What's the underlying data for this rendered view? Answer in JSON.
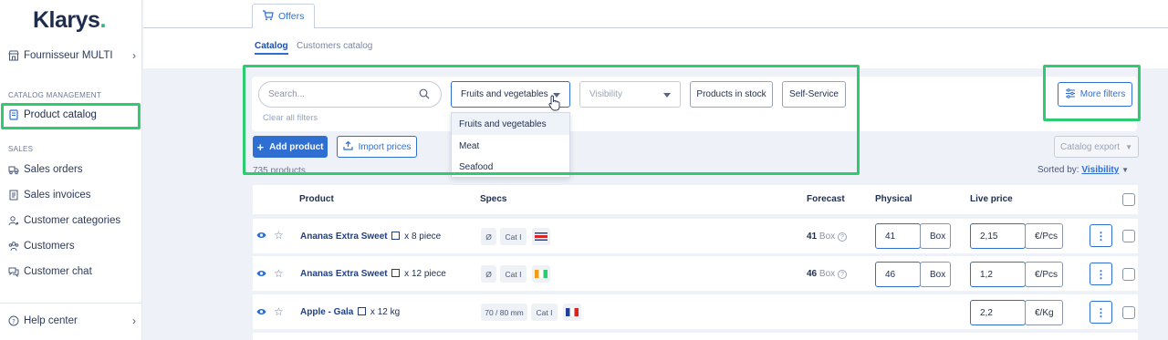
{
  "brand": {
    "name": "Klarys",
    "dot": "."
  },
  "sidebar": {
    "supplier": "Fournisseur MULTI",
    "sections": {
      "catalog_management": "CATALOG MANAGEMENT",
      "sales": "SALES"
    },
    "items": [
      {
        "label": "Product catalog",
        "icon": "book-icon",
        "active": true
      },
      {
        "label": "Sales orders",
        "icon": "truck-icon"
      },
      {
        "label": "Sales invoices",
        "icon": "invoice-icon"
      },
      {
        "label": "Customer categories",
        "icon": "users-icon"
      },
      {
        "label": "Customers",
        "icon": "people-icon"
      },
      {
        "label": "Customer chat",
        "icon": "chat-icon"
      }
    ],
    "help": "Help center"
  },
  "top_tab": {
    "label": "Offers",
    "icon": "cart-icon"
  },
  "subtabs": {
    "catalog": "Catalog",
    "customers_catalog": "Customers catalog"
  },
  "filters": {
    "search_placeholder": "Search...",
    "category_selected": "Fruits and vegetables",
    "visibility_placeholder": "Visibility",
    "products_in_stock": "Products in stock",
    "self_service": "Self-Service",
    "clear_all": "Clear all filters",
    "more_filters": "More filters",
    "category_options": [
      "Fruits and vegetables",
      "Meat",
      "Seafood"
    ]
  },
  "actions": {
    "add_product": "Add product",
    "import_prices": "Import prices",
    "catalog_export": "Catalog export"
  },
  "summary": {
    "count": "735 products",
    "sorted_by_label": "Sorted by:",
    "sorted_by_value": "Visibility"
  },
  "columns": {
    "product": "Product",
    "specs": "Specs",
    "forecast": "Forecast",
    "physical": "Physical",
    "live_price": "Live price"
  },
  "rows": [
    {
      "name": "Ananas Extra Sweet",
      "pack": "x 8 piece",
      "specs": [
        "Ø",
        "Cat I"
      ],
      "flag": "costa-rica",
      "forecast_value": "41",
      "forecast_unit": "Box",
      "physical_qty": "41",
      "physical_unit": "Box",
      "price": "2,15",
      "price_unit": "€/Pcs"
    },
    {
      "name": "Ananas Extra Sweet",
      "pack": "x 12 piece",
      "specs": [
        "Ø",
        "Cat I"
      ],
      "flag": "ivory-coast",
      "forecast_value": "46",
      "forecast_unit": "Box",
      "physical_qty": "46",
      "physical_unit": "Box",
      "price": "1,2",
      "price_unit": "€/Pcs"
    },
    {
      "name": "Apple - Gala",
      "pack": "x 12 kg",
      "specs": [
        "70 / 80 mm",
        "Cat I"
      ],
      "flag": "france",
      "forecast_value": "",
      "forecast_unit": "",
      "physical_qty": "",
      "physical_unit": "",
      "price": "2,2",
      "price_unit": "€/Kg"
    }
  ],
  "colors": {
    "primary": "#2f6fd1",
    "highlight": "#2ecc71",
    "brand_dot": "#2fb67c",
    "text": "#1f2d4d"
  }
}
